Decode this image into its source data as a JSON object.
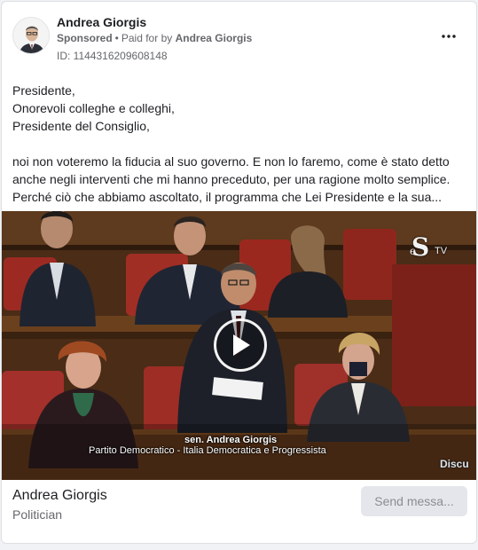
{
  "ad": {
    "page_name": "Andrea Giorgis",
    "sponsored_label": "Sponsored",
    "separator": "•",
    "paid_for_prefix": "Paid for by",
    "payer": "Andrea Giorgis",
    "ad_id": "ID: 1144316209608148",
    "more_icon": "more-horizontal-icon"
  },
  "body": {
    "lines": [
      "Presidente,",
      "Onorevoli colleghe e colleghi,",
      "Presidente del Consiglio,",
      "noi non voteremo la fiducia al suo governo. E non lo faremo, come è stato detto",
      "anche negli interventi che mi hanno preceduto, per una ragione molto semplice.",
      "Perché ciò che abbiamo ascoltato, il programma che Lei Presidente e la sua..."
    ]
  },
  "video": {
    "caption_name": "sen. Andrea Giorgis",
    "caption_party": "Partito Democratico - Italia Democratica e Progressista",
    "caption_extra": "Discu",
    "logo_letter": "S",
    "logo_small": "e",
    "logo_tv": "TV",
    "play_icon": "play-icon"
  },
  "footer": {
    "name": "Andrea Giorgis",
    "category": "Politician",
    "cta_label": "Send messa..."
  },
  "colors": {
    "text_primary": "#1c1e21",
    "text_secondary": "#65676b",
    "button_bg": "#e4e6eb",
    "button_text": "#8a8d91",
    "seat_red": "#9c2a22"
  }
}
